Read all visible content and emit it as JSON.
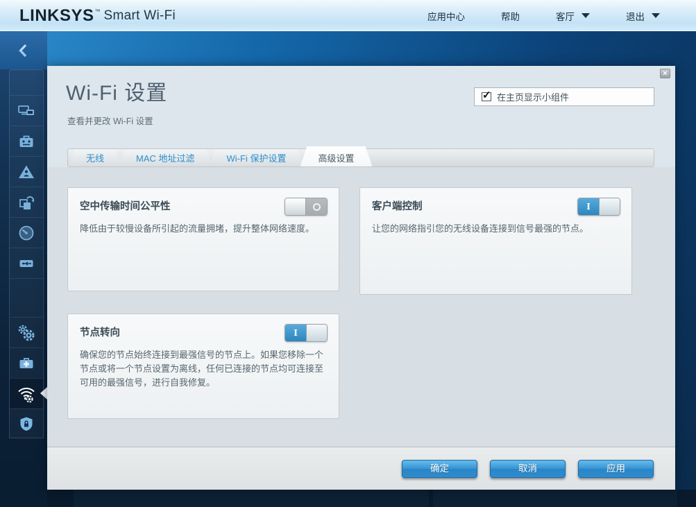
{
  "header": {
    "logo": "LINKSYS",
    "logo_tm": "™",
    "product": "Smart Wi-Fi",
    "menu": [
      {
        "label": "应用中心",
        "caret": false
      },
      {
        "label": "帮助",
        "caret": false
      },
      {
        "label": "客厅",
        "caret": true
      },
      {
        "label": "退出",
        "caret": true
      }
    ]
  },
  "sidebar": {
    "back_icon": "chevron-left-icon",
    "icons": [
      "devices-icon",
      "guest-access-icon",
      "parental-controls-icon",
      "media-prioritization-icon",
      "speed-test-icon",
      "external-storage-icon",
      "connectivity-icon",
      "troubleshooting-icon",
      "wifi-settings-icon",
      "security-icon"
    ],
    "active_icon": "wifi-settings-icon"
  },
  "modal": {
    "title": "Wi-Fi 设置",
    "subtitle": "查看并更改 Wi-Fi 设置",
    "widget_checkbox": {
      "label": "在主页显示小组件",
      "checked": true
    },
    "tabs": [
      {
        "label": "无线",
        "active": false
      },
      {
        "label": "MAC 地址过滤",
        "active": false
      },
      {
        "label": "Wi-Fi 保护设置",
        "active": false
      },
      {
        "label": "高级设置",
        "active": true
      }
    ],
    "cards": [
      {
        "title": "空中传输时间公平性",
        "description": "降低由于较慢设备所引起的流量拥堵，提升整体网络速度。",
        "toggle": "off"
      },
      {
        "title": "客户端控制",
        "description": "让您的网络指引您的无线设备连接到信号最强的节点。",
        "toggle": "on"
      },
      {
        "title": "节点转向",
        "description": "确保您的节点始终连接到最强信号的节点上。如果您移除一个节点或将一个节点设置为离线，任何已连接的节点均可连接至可用的最强信号，进行自我修复。",
        "toggle": "on"
      }
    ],
    "toggle_on_glyph": "I",
    "buttons": [
      {
        "label": "确定"
      },
      {
        "label": "取消"
      },
      {
        "label": "应用"
      }
    ]
  },
  "colors": {
    "accent_blue": "#2e8fcd",
    "button_blue": "#2a85c6",
    "toggle_on_blue": "#3795d4",
    "sidebar_navy": "#122f4e",
    "header_light_blue": "#c3e2f5",
    "modal_bg": "#dde6ec",
    "sidebar_icon_blue": "#79b1dc"
  }
}
